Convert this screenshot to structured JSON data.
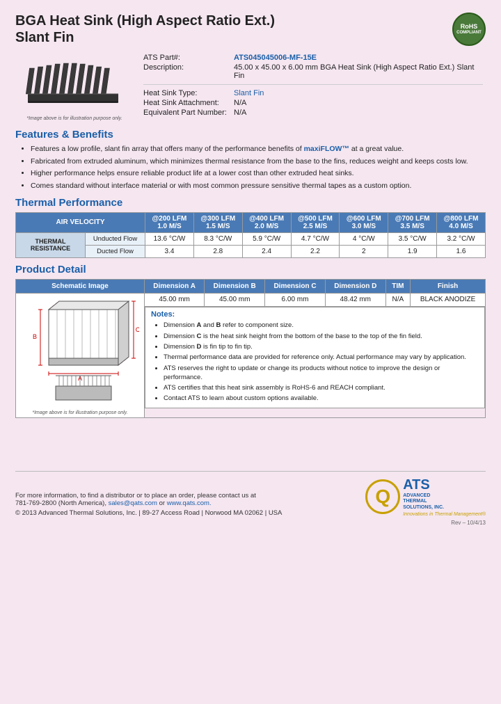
{
  "header": {
    "title_line1": "BGA Heat Sink (High Aspect Ratio Ext.)",
    "title_line2": "Slant Fin",
    "rohs": "RoHS\nCOMPLIANT"
  },
  "product_info": {
    "part_label": "ATS Part#:",
    "part_number": "ATS045045006-MF-15E",
    "description_label": "Description:",
    "description": "45.00 x 45.00 x 6.00 mm  BGA Heat Sink (High Aspect Ratio Ext.) Slant Fin",
    "heatsink_type_label": "Heat Sink Type:",
    "heatsink_type": "Slant Fin",
    "heatsink_attachment_label": "Heat Sink Attachment:",
    "heatsink_attachment": "N/A",
    "equivalent_part_label": "Equivalent Part Number:",
    "equivalent_part": "N/A",
    "image_caption": "*Image above is for illustration purpose only."
  },
  "features": {
    "section_title": "Features & Benefits",
    "items": [
      "Features a low profile, slant fin array that offers many of the performance benefits of maxiFLOW™ at a great value.",
      "Fabricated from extruded aluminum, which minimizes thermal resistance from the base to the fins, reduces weight and keeps costs low.",
      "Higher performance helps ensure reliable product life at a lower cost than other extruded heat sinks.",
      "Comes standard without interface material or with most common pressure sensitive thermal tapes as a custom option."
    ],
    "highlight_text": "maxiFLOW™"
  },
  "thermal_performance": {
    "section_title": "Thermal Performance",
    "table": {
      "col_header_label": "AIR VELOCITY",
      "columns": [
        "@200 LFM\n1.0 M/S",
        "@300 LFM\n1.5 M/S",
        "@400 LFM\n2.0 M/S",
        "@500 LFM\n2.5 M/S",
        "@600 LFM\n3.0 M/S",
        "@700 LFM\n3.5 M/S",
        "@800 LFM\n4.0 M/S"
      ],
      "row_label": "THERMAL RESISTANCE",
      "rows": [
        {
          "label": "Unducted Flow",
          "values": [
            "13.6 °C/W",
            "8.3 °C/W",
            "5.9 °C/W",
            "4.7 °C/W",
            "4 °C/W",
            "3.5 °C/W",
            "3.2 °C/W"
          ]
        },
        {
          "label": "Ducted Flow",
          "values": [
            "3.4",
            "2.8",
            "2.4",
            "2.2",
            "2",
            "1.9",
            "1.6"
          ]
        }
      ]
    }
  },
  "product_detail": {
    "section_title": "Product Detail",
    "columns": [
      "Schematic Image",
      "Dimension A",
      "Dimension B",
      "Dimension C",
      "Dimension D",
      "TIM",
      "Finish"
    ],
    "values": {
      "dim_a": "45.00 mm",
      "dim_b": "45.00 mm",
      "dim_c": "6.00 mm",
      "dim_d": "48.42 mm",
      "tim": "N/A",
      "finish": "BLACK ANODIZE"
    },
    "image_caption": "*Image above is for illustration purpose only.",
    "notes_title": "Notes:",
    "notes": [
      "Dimension A and B refer to component size.",
      "Dimension C is the heat sink height from the bottom of the base to the top of the fin field.",
      "Dimension D is fin tip to fin tip.",
      "Thermal performance data are provided for reference only. Actual performance may vary by application.",
      "ATS reserves the right to update or change its products without notice to improve the design or performance.",
      "ATS certifies that this heat sink assembly is RoHS-6 and REACH compliant.",
      "Contact ATS to learn about custom options available."
    ],
    "notes_bold_parts": [
      "A",
      "B",
      "C",
      "D"
    ]
  },
  "footer": {
    "contact_line": "For more information, to find a distributor or to place an order, please contact us at",
    "phone": "781-769-2800 (North America)",
    "email": "sales@qats.com",
    "or": "or",
    "website": "www.qats.com.",
    "copyright": "© 2013 Advanced Thermal Solutions, Inc. | 89-27 Access Road | Norwood MA  02062 | USA",
    "ats_q": "Q",
    "ats_name": "ATS",
    "ats_fullname_line1": "ADVANCED",
    "ats_fullname_line2": "THERMAL",
    "ats_fullname_line3": "SOLUTIONS, INC.",
    "ats_tagline": "Innovations in Thermal Management®",
    "page_number": "Rev – 10/4/13"
  }
}
